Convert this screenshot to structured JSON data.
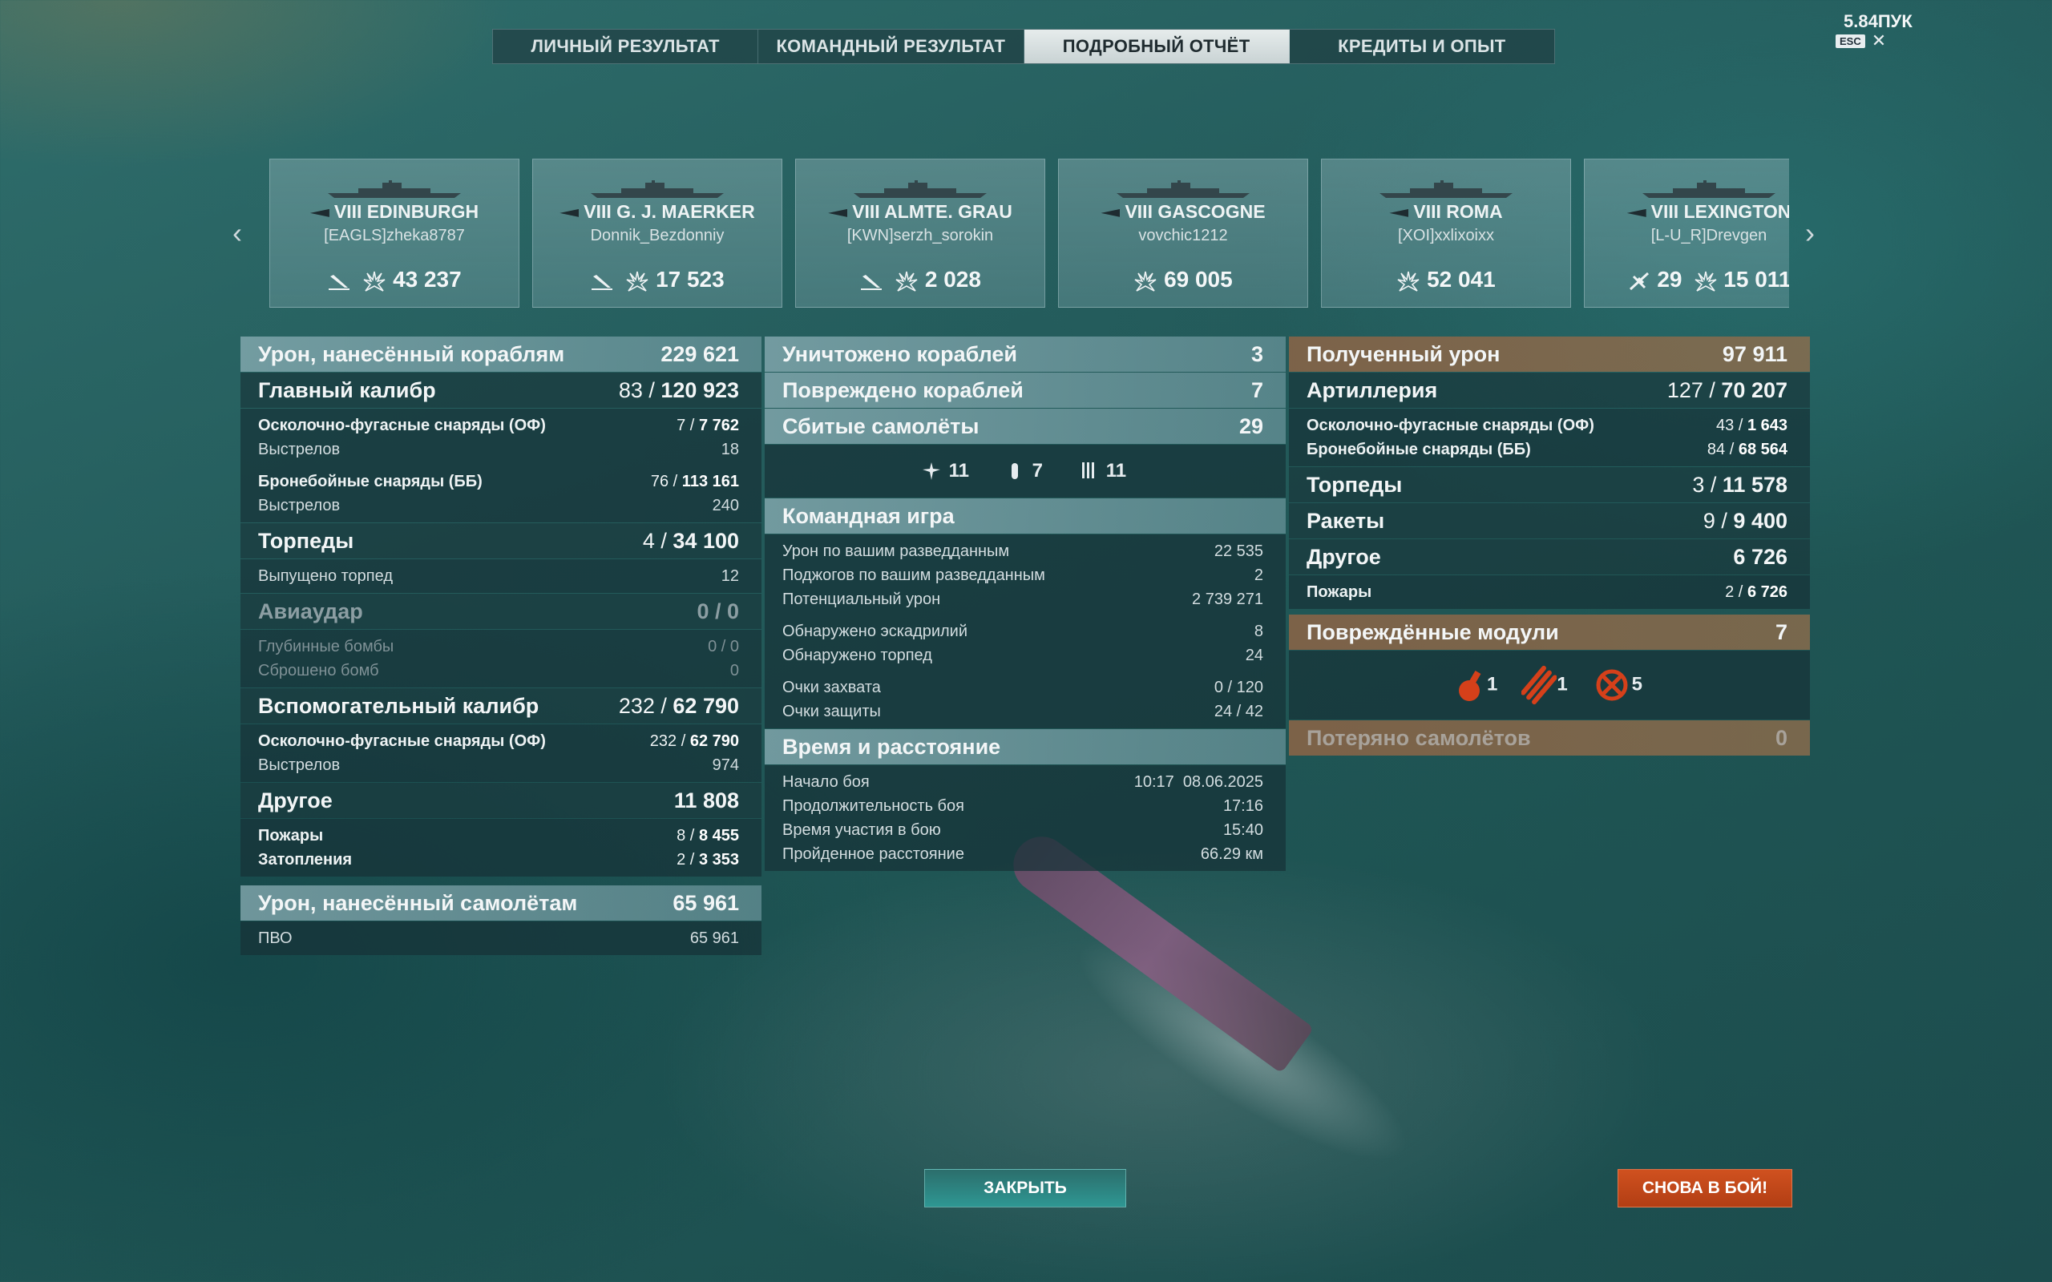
{
  "tabs": [
    "ЛИЧНЫЙ РЕЗУЛЬТАТ",
    "КОМАНДНЫЙ РЕЗУЛЬТАТ",
    "ПОДРОБНЫЙ ОТЧЁТ",
    "КРЕДИТЫ И ОПЫТ"
  ],
  "rate": "5.84ПУК",
  "esc": "ESC",
  "ships": [
    {
      "name": "VIII EDINBURGH",
      "player": "[EAGLS]zheka8787",
      "kills_icon": "torpedo-hit-icon",
      "damage": "43 237"
    },
    {
      "name": "VIII G. J. MAERKER",
      "player": "Donnik_Bezdonniy",
      "kills_icon": "torpedo-hit-icon",
      "damage": "17 523"
    },
    {
      "name": "VIII ALMTE. GRAU",
      "player": "[KWN]serzh_sorokin",
      "kills_icon": "torpedo-hit-icon",
      "damage": "2 028"
    },
    {
      "name": "VIII GASCOGNE",
      "player": "vovchic1212",
      "damage": "69 005"
    },
    {
      "name": "VIII ROMA",
      "player": "[XOI]xxlixoixx",
      "damage": "52 041"
    },
    {
      "name": "VIII LEXINGTON",
      "player": "[L-U_R]Drevgen",
      "planes": "29",
      "damage": "15 011"
    }
  ],
  "left": {
    "dmg_ships": {
      "label": "Урон, нанесённый кораблям",
      "value": "229 621"
    },
    "main": {
      "label": "Главный калибр",
      "hits": "83 /",
      "value": "120 923"
    },
    "he": {
      "label": "Осколочно-фугасные снаряды (ОФ)",
      "hits": "7 /",
      "value": "7 762"
    },
    "he_shots": {
      "label": "Выстрелов",
      "value": "18"
    },
    "ap": {
      "label": "Бронебойные снаряды (ББ)",
      "hits": "76 /",
      "value": "113 161"
    },
    "ap_shots": {
      "label": "Выстрелов",
      "value": "240"
    },
    "torp": {
      "label": "Торпеды",
      "hits": "4 /",
      "value": "34 100"
    },
    "torp_fired": {
      "label": "Выпущено торпед",
      "value": "12"
    },
    "air": {
      "label": "Авиаудар",
      "value": "0 / 0"
    },
    "depth": {
      "label": "Глубинные бомбы",
      "value": "0 / 0"
    },
    "bombs": {
      "label": "Сброшено бомб",
      "value": "0"
    },
    "sec": {
      "label": "Вспомогательный калибр",
      "hits": "232 /",
      "value": "62 790"
    },
    "sec_he": {
      "label": "Осколочно-фугасные снаряды (ОФ)",
      "hits": "232 /",
      "value": "62 790"
    },
    "sec_shots": {
      "label": "Выстрелов",
      "value": "974"
    },
    "other": {
      "label": "Другое",
      "value": "11 808"
    },
    "fires": {
      "label": "Пожары",
      "hits": "8 /",
      "value": "8 455"
    },
    "floods": {
      "label": "Затопления",
      "hits": "2 /",
      "value": "3 353"
    },
    "dmg_planes": {
      "label": "Урон, нанесённый самолётам",
      "value": "65 961"
    },
    "aa": {
      "label": "ПВО",
      "value": "65 961"
    }
  },
  "mid": {
    "destroyed": {
      "label": "Уничтожено кораблей",
      "value": "3"
    },
    "damaged": {
      "label": "Повреждено кораблей",
      "value": "7"
    },
    "planes": {
      "label": "Сбитые самолёты",
      "value": "29"
    },
    "plane_types": [
      {
        "icon": "fighter-icon",
        "value": "11"
      },
      {
        "icon": "bomber-icon",
        "value": "7"
      },
      {
        "icon": "torpedo-bomber-icon",
        "value": "11"
      }
    ],
    "team": {
      "label": "Командная игра"
    },
    "spot_dmg": {
      "label": "Урон по вашим разведданным",
      "value": "22 535"
    },
    "spot_fires": {
      "label": "Поджогов по вашим разведданным",
      "value": "2"
    },
    "potential": {
      "label": "Потенциальный урон",
      "value": "2 739 271"
    },
    "squads": {
      "label": "Обнаружено эскадрилий",
      "value": "8"
    },
    "torps": {
      "label": "Обнаружено торпед",
      "value": "24"
    },
    "capture": {
      "label": "Очки захвата",
      "value": "0 / 120"
    },
    "defense": {
      "label": "Очки защиты",
      "value": "24 / 42"
    },
    "time": {
      "label": "Время и расстояние"
    },
    "start": {
      "label": "Начало боя",
      "value": "10:17  08.06.2025"
    },
    "duration": {
      "label": "Продолжительность боя",
      "value": "17:16"
    },
    "participation": {
      "label": "Время участия в бою",
      "value": "15:40"
    },
    "distance": {
      "label": "Пройденное расстояние",
      "value": "66.29 км"
    }
  },
  "right": {
    "received": {
      "label": "Полученный урон",
      "value": "97 911"
    },
    "art": {
      "label": "Артиллерия",
      "hits": "127 /",
      "value": "70 207"
    },
    "he": {
      "label": "Осколочно-фугасные снаряды (ОФ)",
      "hits": "43 /",
      "value": "1 643"
    },
    "ap": {
      "label": "Бронебойные снаряды (ББ)",
      "hits": "84 /",
      "value": "68 564"
    },
    "torp": {
      "label": "Торпеды",
      "hits": "3 /",
      "value": "11 578"
    },
    "rockets": {
      "label": "Ракеты",
      "hits": "9 /",
      "value": "9 400"
    },
    "other": {
      "label": "Другое",
      "value": "6 726"
    },
    "fires": {
      "label": "Пожары",
      "hits": "2 /",
      "value": "6 726"
    },
    "modules": {
      "label": "Повреждённые модули",
      "value": "7"
    },
    "module_icons": [
      {
        "icon": "turret-icon",
        "value": "1"
      },
      {
        "icon": "torpedo-tubes-icon",
        "value": "1"
      },
      {
        "icon": "engine-icon",
        "value": "5"
      }
    ],
    "lost_planes": {
      "label": "Потеряно самолётов",
      "value": "0"
    }
  },
  "buttons": {
    "close": "ЗАКРЫТЬ",
    "battle": "СНОВА В БОЙ!"
  },
  "colors": {
    "accent_brown": "#8c6446",
    "battle_btn": "#c2451c",
    "close_btn": "#2d8a86"
  }
}
